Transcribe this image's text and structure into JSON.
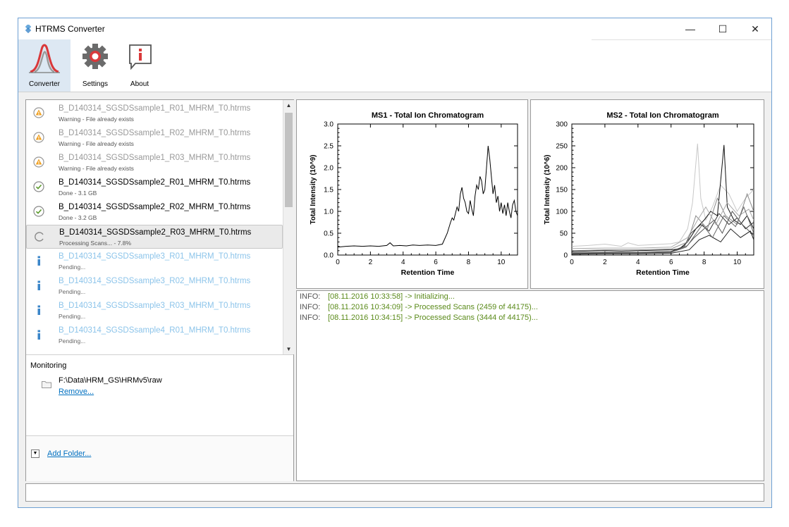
{
  "window": {
    "title": "HTRMS Converter"
  },
  "ribbon": {
    "buttons": [
      {
        "label": "Converter",
        "icon": "chromatogram-peak-icon",
        "active": true
      },
      {
        "label": "Settings",
        "icon": "gear-icon",
        "active": false
      },
      {
        "label": "About",
        "icon": "info-speech-icon",
        "active": false
      }
    ]
  },
  "file_list": {
    "items": [
      {
        "name": "B_D140314_SGSDSsample1_R01_MHRM_T0.htrms",
        "status": "Warning - File already exists",
        "state": "warning",
        "icon": "warning-icon"
      },
      {
        "name": "B_D140314_SGSDSsample1_R02_MHRM_T0.htrms",
        "status": "Warning - File already exists",
        "state": "warning",
        "icon": "warning-icon"
      },
      {
        "name": "B_D140314_SGSDSsample1_R03_MHRM_T0.htrms",
        "status": "Warning - File already exists",
        "state": "warning",
        "icon": "warning-icon"
      },
      {
        "name": "B_D140314_SGSDSsample2_R01_MHRM_T0.htrms",
        "status": "Done - 3.1 GB",
        "state": "done",
        "icon": "check-circle-icon"
      },
      {
        "name": "B_D140314_SGSDSsample2_R02_MHRM_T0.htrms",
        "status": "Done - 3.2 GB",
        "state": "done",
        "icon": "check-circle-icon"
      },
      {
        "name": "B_D140314_SGSDSsample2_R03_MHRM_T0.htrms",
        "status": "Processing Scans... - 7.8%",
        "state": "processing",
        "icon": "spinner-icon"
      },
      {
        "name": "B_D140314_SGSDSsample3_R01_MHRM_T0.htrms",
        "status": "Pending...",
        "state": "pending",
        "icon": "info-icon"
      },
      {
        "name": "B_D140314_SGSDSsample3_R02_MHRM_T0.htrms",
        "status": "Pending...",
        "state": "pending",
        "icon": "info-icon"
      },
      {
        "name": "B_D140314_SGSDSsample3_R03_MHRM_T0.htrms",
        "status": "Pending...",
        "state": "pending",
        "icon": "info-icon"
      },
      {
        "name": "B_D140314_SGSDSsample4_R01_MHRM_T0.htrms",
        "status": "Pending...",
        "state": "pending",
        "icon": "info-icon"
      }
    ]
  },
  "monitoring": {
    "title": "Monitoring",
    "path": "F:\\Data\\HRM_GS\\HRMv5\\raw",
    "remove_label": "Remove..."
  },
  "add_folder": {
    "label": "Add Folder..."
  },
  "log": {
    "lines": [
      {
        "level": "INFO:",
        "message": "[08.11.2016 10:33:58] -> Initializing..."
      },
      {
        "level": "INFO:",
        "message": "[08.11.2016 10:34:09] -> Processed Scans (2459 of 44175)..."
      },
      {
        "level": "INFO:",
        "message": "[08.11.2016 10:34:15] -> Processed Scans (3444 of 44175)..."
      }
    ]
  },
  "colors": {
    "accent": "#d9383a",
    "link": "#0070c0",
    "log_text": "#5a8a1a",
    "pending_text": "#8cc4ea"
  },
  "chart_data": [
    {
      "type": "line",
      "title": "MS1 - Total Ion Chromatogram",
      "xlabel": "Retention Time",
      "ylabel": "Total Intensity (10^9)",
      "xlim": [
        0,
        11
      ],
      "ylim": [
        0,
        3.0
      ],
      "xticks": [
        "0",
        "2",
        "4",
        "6",
        "8",
        "10"
      ],
      "yticks": [
        "0.0",
        "0.5",
        "1.0",
        "1.5",
        "2.0",
        "2.5",
        "3.0"
      ],
      "series": [
        {
          "color": "#000000",
          "x": [
            0,
            0.5,
            1,
            1.5,
            2,
            2.5,
            3,
            3.2,
            3.4,
            3.8,
            4.2,
            4.6,
            5,
            5.5,
            6,
            6.4,
            6.7,
            6.9,
            7.0,
            7.1,
            7.2,
            7.3,
            7.4,
            7.5,
            7.6,
            7.7,
            7.8,
            7.9,
            8.0,
            8.1,
            8.2,
            8.3,
            8.4,
            8.5,
            8.6,
            8.7,
            8.8,
            8.9,
            9.0,
            9.1,
            9.2,
            9.3,
            9.4,
            9.5,
            9.6,
            9.7,
            9.8,
            9.9,
            10.0,
            10.1,
            10.2,
            10.3,
            10.4,
            10.5,
            10.6,
            10.7,
            10.8,
            10.9,
            11
          ],
          "y": [
            0.18,
            0.2,
            0.21,
            0.2,
            0.21,
            0.2,
            0.22,
            0.28,
            0.21,
            0.22,
            0.21,
            0.23,
            0.22,
            0.23,
            0.22,
            0.25,
            0.5,
            0.75,
            0.85,
            0.8,
            0.95,
            1.1,
            1.0,
            1.4,
            1.55,
            1.3,
            1.2,
            1.0,
            0.95,
            1.25,
            1.05,
            0.9,
            1.35,
            1.6,
            1.5,
            1.8,
            1.7,
            1.4,
            1.5,
            2.0,
            2.5,
            2.2,
            1.8,
            1.4,
            1.6,
            1.2,
            1.35,
            1.0,
            1.2,
            0.95,
            1.15,
            0.9,
            1.2,
            1.0,
            0.85,
            1.15,
            1.25,
            1.0,
            0.9
          ]
        }
      ]
    },
    {
      "type": "line",
      "title": "MS2 - Total Ion Chromatogram",
      "xlabel": "Retention Time",
      "ylabel": "Total Intensity (10^6)",
      "xlim": [
        0,
        11
      ],
      "ylim": [
        0,
        300
      ],
      "xticks": [
        "0",
        "2",
        "4",
        "6",
        "8",
        "10"
      ],
      "yticks": [
        "0",
        "50",
        "100",
        "150",
        "200",
        "250",
        "300"
      ],
      "series": [
        {
          "color": "#c8c8c8",
          "x": [
            0,
            1,
            2,
            3,
            3.4,
            4,
            5,
            6,
            6.5,
            7,
            7.3,
            7.6,
            7.8,
            8.1,
            8.5,
            9,
            9.5,
            10,
            10.5,
            11
          ],
          "y": [
            20,
            22,
            25,
            20,
            28,
            22,
            24,
            26,
            30,
            60,
            120,
            255,
            130,
            80,
            110,
            160,
            140,
            100,
            130,
            150
          ]
        },
        {
          "color": "#111111",
          "x": [
            0,
            1,
            2,
            3,
            4,
            5,
            6,
            6.5,
            7,
            7.5,
            8,
            8.4,
            8.8,
            9.0,
            9.2,
            9.4,
            9.8,
            10.2,
            10.6,
            11
          ],
          "y": [
            8,
            9,
            10,
            9,
            10,
            11,
            12,
            14,
            30,
            60,
            80,
            100,
            90,
            170,
            252,
            110,
            80,
            70,
            90,
            60
          ]
        },
        {
          "color": "#333333",
          "x": [
            0,
            2,
            4,
            6,
            6.8,
            7.2,
            7.8,
            8.3,
            8.9,
            9.5,
            10,
            10.5,
            11
          ],
          "y": [
            5,
            6,
            6,
            8,
            20,
            50,
            70,
            55,
            95,
            70,
            85,
            60,
            75
          ]
        },
        {
          "color": "#555555",
          "x": [
            0,
            2,
            4,
            6,
            6.9,
            7.4,
            8,
            8.6,
            9.1,
            9.7,
            10.3,
            11
          ],
          "y": [
            3,
            4,
            5,
            6,
            18,
            40,
            60,
            80,
            50,
            100,
            70,
            45
          ]
        },
        {
          "color": "#888888",
          "x": [
            0,
            2,
            4,
            6,
            7,
            7.5,
            8.2,
            8.8,
            9.3,
            10,
            10.6,
            11
          ],
          "y": [
            10,
            12,
            12,
            14,
            30,
            90,
            60,
            130,
            90,
            70,
            140,
            100
          ]
        },
        {
          "color": "#aaaaaa",
          "x": [
            0,
            2,
            4,
            6,
            7,
            7.6,
            8.1,
            8.7,
            9.4,
            10.1,
            10.7,
            11
          ],
          "y": [
            15,
            16,
            16,
            18,
            40,
            80,
            110,
            70,
            120,
            90,
            105,
            80
          ]
        },
        {
          "color": "#222222",
          "x": [
            0,
            2,
            4,
            6,
            7.1,
            7.7,
            8.3,
            9,
            9.6,
            10.2,
            10.8,
            11
          ],
          "y": [
            2,
            3,
            3,
            4,
            12,
            35,
            45,
            30,
            60,
            40,
            55,
            35
          ]
        },
        {
          "color": "#666666",
          "x": [
            0,
            2,
            4,
            6,
            7,
            7.9,
            8.5,
            9.2,
            9.9,
            10.4,
            11
          ],
          "y": [
            4,
            5,
            5,
            6,
            22,
            70,
            40,
            90,
            65,
            110,
            50
          ]
        }
      ]
    }
  ]
}
